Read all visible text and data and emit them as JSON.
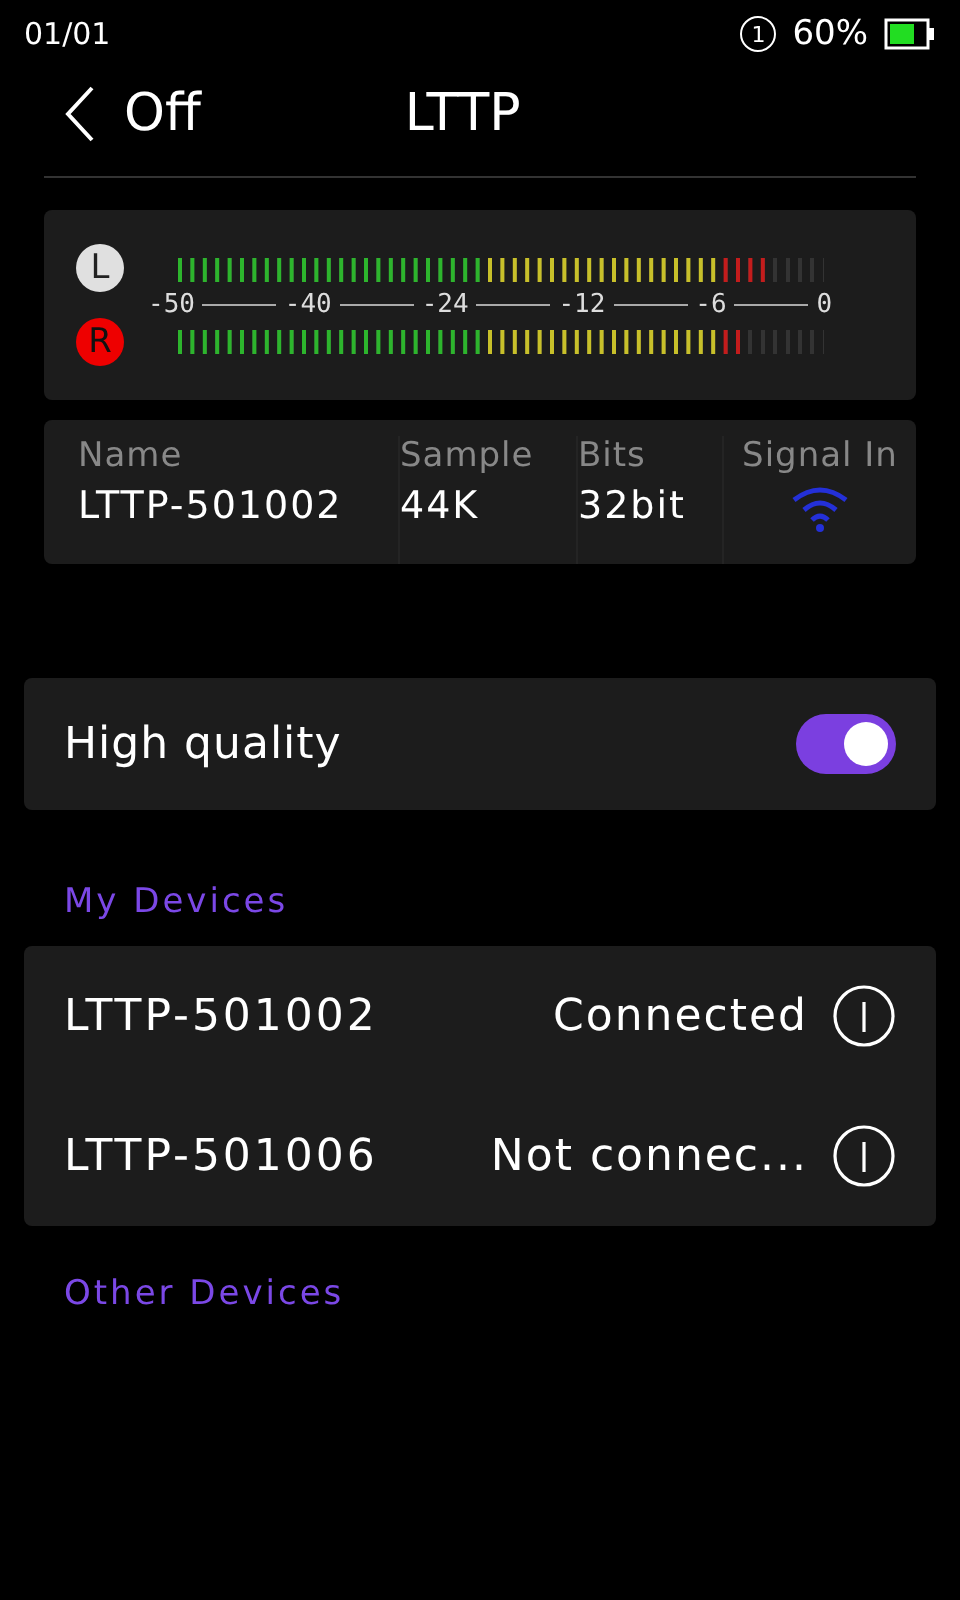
{
  "status_bar": {
    "page": "01/01",
    "sync_badge": "1",
    "battery_text": "60%"
  },
  "nav": {
    "back_label": "Off",
    "title": "LTTP"
  },
  "meter": {
    "channels": [
      {
        "label": "L",
        "level": 0.92,
        "color": "#e0e0e0"
      },
      {
        "label": "R",
        "level": 0.88,
        "color": "#ee0000"
      }
    ],
    "scale": [
      "-50",
      "-40",
      "-24",
      "-12",
      "-6",
      "0"
    ]
  },
  "info": {
    "columns": [
      {
        "heading": "Name",
        "value": "LTTP-501002",
        "kind": "text"
      },
      {
        "heading": "Sample",
        "value": "44K",
        "kind": "text"
      },
      {
        "heading": "Bits",
        "value": "32bit",
        "kind": "text"
      },
      {
        "heading": "Signal In",
        "kind": "signal"
      }
    ]
  },
  "high_quality": {
    "label": "High quality",
    "on": true
  },
  "my_devices": {
    "heading": "My Devices",
    "items": [
      {
        "name": "LTTP-501002",
        "status": "Connected"
      },
      {
        "name": "LTTP-501006",
        "status": "Not connec..."
      }
    ]
  },
  "other_devices": {
    "heading": "Other Devices"
  }
}
